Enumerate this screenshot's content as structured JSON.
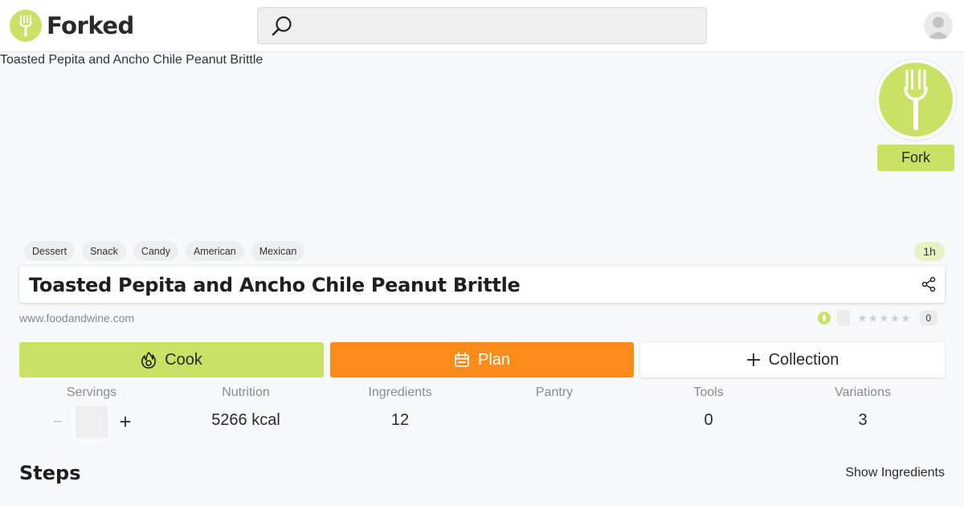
{
  "header": {
    "logo_text": "Forked",
    "search_placeholder": "",
    "search_icon": "search-icon",
    "avatar_icon": "user-avatar-icon"
  },
  "hero": {
    "image_alt": "Toasted Pepita and Ancho Chile Peanut Brittle",
    "fork_icon": "fork-icon",
    "fork_button_label": "Fork"
  },
  "tags": [
    "Dessert",
    "Snack",
    "Candy",
    "American",
    "Mexican"
  ],
  "time_badge": "1h",
  "recipe": {
    "title": "Toasted Pepita and Ancho Chile Peanut Brittle",
    "source": "www.foodandwine.com",
    "rating_count": "0",
    "stars": "★★★★★"
  },
  "actions": {
    "cook_label": "Cook",
    "plan_label": "Plan",
    "collection_label": "Collection"
  },
  "stats": {
    "servings": {
      "label": "Servings",
      "minus": "−",
      "plus": "+"
    },
    "nutrition": {
      "label": "Nutrition",
      "value": "5266 kcal"
    },
    "ingredients": {
      "label": "Ingredients",
      "value": "12"
    },
    "pantry": {
      "label": "Pantry",
      "value": ""
    },
    "tools": {
      "label": "Tools",
      "value": "0"
    },
    "variations": {
      "label": "Variations",
      "value": "3"
    }
  },
  "steps": {
    "heading": "Steps",
    "show_ingredients_label": "Show Ingredients"
  },
  "colors": {
    "brand_green": "#c9e265",
    "plan_orange": "#fb8c1c"
  }
}
